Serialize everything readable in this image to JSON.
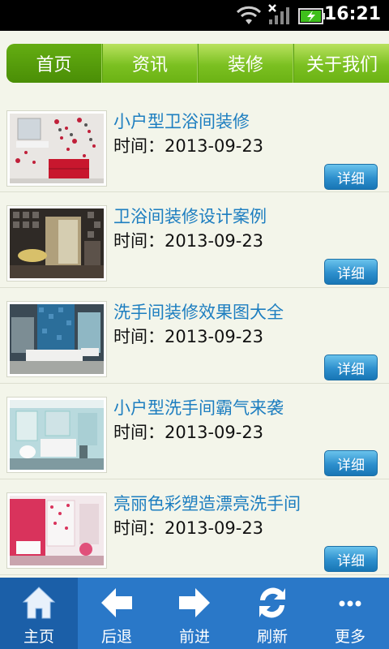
{
  "status_bar": {
    "time": "16:21"
  },
  "tabs": [
    {
      "label": "首页",
      "active": true
    },
    {
      "label": "资讯",
      "active": false
    },
    {
      "label": "装修",
      "active": false
    },
    {
      "label": "关于我们",
      "active": false
    }
  ],
  "articles": [
    {
      "title": "小户型卫浴间装修",
      "time": "时间：2013-09-23",
      "button": "详细"
    },
    {
      "title": "卫浴间装修设计案例",
      "time": "时间：2013-09-23",
      "button": "详细"
    },
    {
      "title": "洗手间装修效果图大全",
      "time": "时间：2013-09-23",
      "button": "详细"
    },
    {
      "title": "小户型洗手间霸气来袭",
      "time": "时间：2013-09-23",
      "button": "详细"
    },
    {
      "title": "亮丽色彩塑造漂亮洗手间",
      "time": "时间：2013-09-23",
      "button": "详细"
    }
  ],
  "bottom_nav": [
    {
      "label": "主页",
      "icon": "home-icon",
      "active": true
    },
    {
      "label": "后退",
      "icon": "back-arrow-icon",
      "active": false
    },
    {
      "label": "前进",
      "icon": "forward-arrow-icon",
      "active": false
    },
    {
      "label": "刷新",
      "icon": "refresh-icon",
      "active": false
    },
    {
      "label": "更多",
      "icon": "more-icon",
      "active": false
    }
  ],
  "colors": {
    "tab_green": "#7bc021",
    "link_blue": "#1d7ec0",
    "button_blue": "#2d8fcd",
    "nav_blue": "#2a78c8"
  }
}
